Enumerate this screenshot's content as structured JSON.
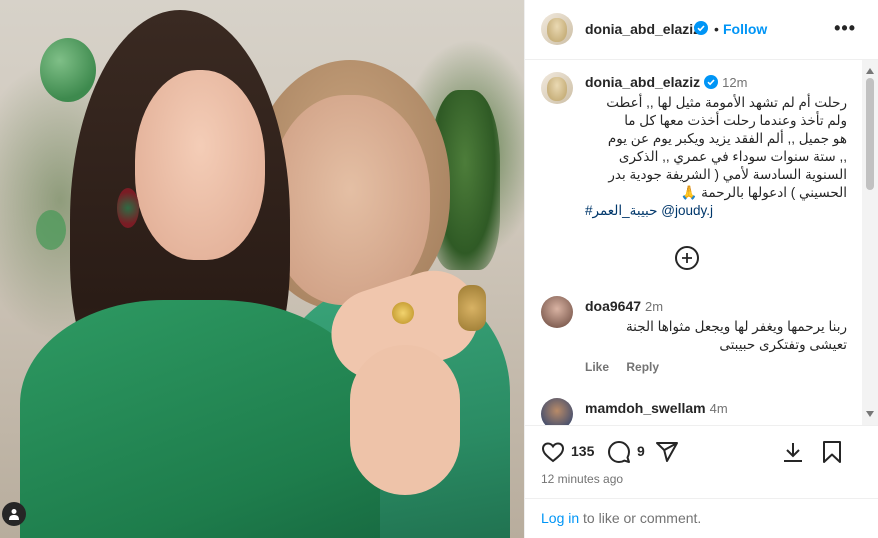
{
  "post": {
    "username": "donia_abd_elaziz",
    "follow_label": "Follow",
    "separator": "•",
    "more_label": "•••",
    "caption": {
      "username": "donia_abd_elaziz",
      "time": "12m",
      "lines": [
        "رحلت أم لم تشهد الأمومة مثيل لها ,, أعطت",
        "ولم تأخذ  وعندما رحلت أخذت معها كل ما",
        "هو جميل ,, ألم الفقد يزيد ويكبر يوم عن يوم",
        ",, ستة سنوات سوداء في عمري ,, الذكرى",
        "السنوية السادسة لأمي ( الشريفة جودية بدر",
        "الحسيني ) ادعولها بالرحمة 🙏"
      ],
      "mention": "@joudy.j",
      "hashtag": "#حبيبة_العمر"
    },
    "comments": [
      {
        "username": "doa9647",
        "time": "2m",
        "lines": [
          "ربنا يرحمها ويغفر لها ويجعل مثواها الجنة",
          "تعيشى وتفتكرى حبيبتى"
        ],
        "like_label": "Like",
        "reply_label": "Reply"
      },
      {
        "username": "mamdoh_swellam",
        "time": "4m"
      }
    ],
    "likes_count": "135",
    "comments_count": "9",
    "timestamp": "12 minutes ago",
    "login_link": "Log in",
    "login_suffix": " to like or comment."
  },
  "colors": {
    "accent": "#0095f6",
    "verified": "#0095f6",
    "muted": "#737373",
    "text": "#262626",
    "link": "#00376b"
  },
  "icons": {
    "verified": "verified-badge-icon",
    "heart": "heart-icon",
    "comment": "comment-icon",
    "share": "share-icon",
    "save": "bookmark-icon",
    "download": "download-icon",
    "add": "plus-circle-icon",
    "profile": "person-icon"
  }
}
